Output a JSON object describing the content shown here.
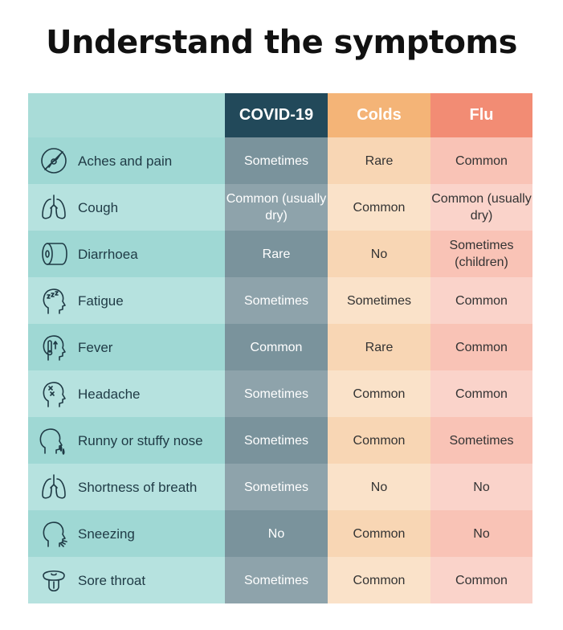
{
  "title": "Understand the symptoms",
  "headers": [
    "",
    "COVID-19",
    "Colds",
    "Flu"
  ],
  "rows": [
    {
      "symptom": "Aches and pain",
      "icon": "aches-icon",
      "covid": "Sometimes",
      "colds": "Rare",
      "flu": "Common"
    },
    {
      "symptom": "Cough",
      "icon": "lungs-icon",
      "covid": "Common (usually dry)",
      "colds": "Common",
      "flu": "Common (usually dry)"
    },
    {
      "symptom": "Diarrhoea",
      "icon": "toilet-paper-icon",
      "covid": "Rare",
      "colds": "No",
      "flu": "Sometimes (children)"
    },
    {
      "symptom": "Fatigue",
      "icon": "sleepy-head-icon",
      "covid": "Sometimes",
      "colds": "Sometimes",
      "flu": "Common"
    },
    {
      "symptom": "Fever",
      "icon": "thermometer-head-icon",
      "covid": "Common",
      "colds": "Rare",
      "flu": "Common"
    },
    {
      "symptom": "Headache",
      "icon": "headache-icon",
      "covid": "Sometimes",
      "colds": "Common",
      "flu": "Common"
    },
    {
      "symptom": "Runny or stuffy nose",
      "icon": "runny-nose-icon",
      "covid": "Sometimes",
      "colds": "Common",
      "flu": "Sometimes"
    },
    {
      "symptom": "Shortness of breath",
      "icon": "lungs-icon",
      "covid": "Sometimes",
      "colds": "No",
      "flu": "No"
    },
    {
      "symptom": "Sneezing",
      "icon": "sneezing-head-icon",
      "covid": "No",
      "colds": "Common",
      "flu": "No"
    },
    {
      "symptom": "Sore throat",
      "icon": "sore-throat-icon",
      "covid": "Sometimes",
      "colds": "Common",
      "flu": "Common"
    }
  ]
}
